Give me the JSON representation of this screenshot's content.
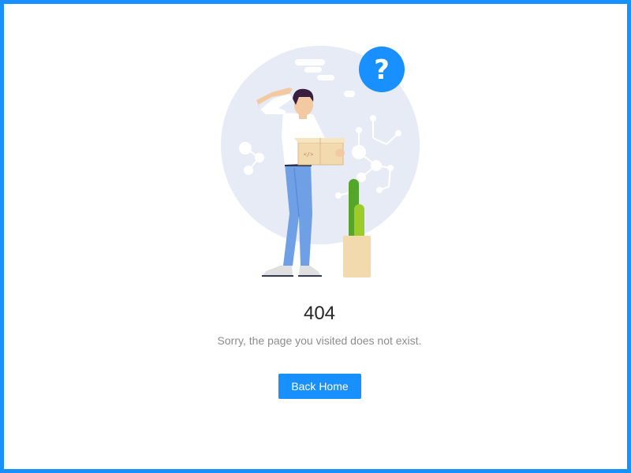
{
  "result": {
    "status": "404",
    "subtitle": "Sorry, the page you visited does not exist.",
    "back_label": "Back Home"
  },
  "illustration": {
    "badge_glyph": "?",
    "box_glyph": "</>",
    "icons": [
      "question-badge-icon",
      "person-holding-box-illustration",
      "cactus-plant-illustration",
      "molecule-decoration-icon",
      "cloud-decoration-icon"
    ]
  },
  "colors": {
    "accent": "#1890ff",
    "circle": "#e6ebf5",
    "title": "#262626",
    "subtitle": "#8c8c8c"
  }
}
